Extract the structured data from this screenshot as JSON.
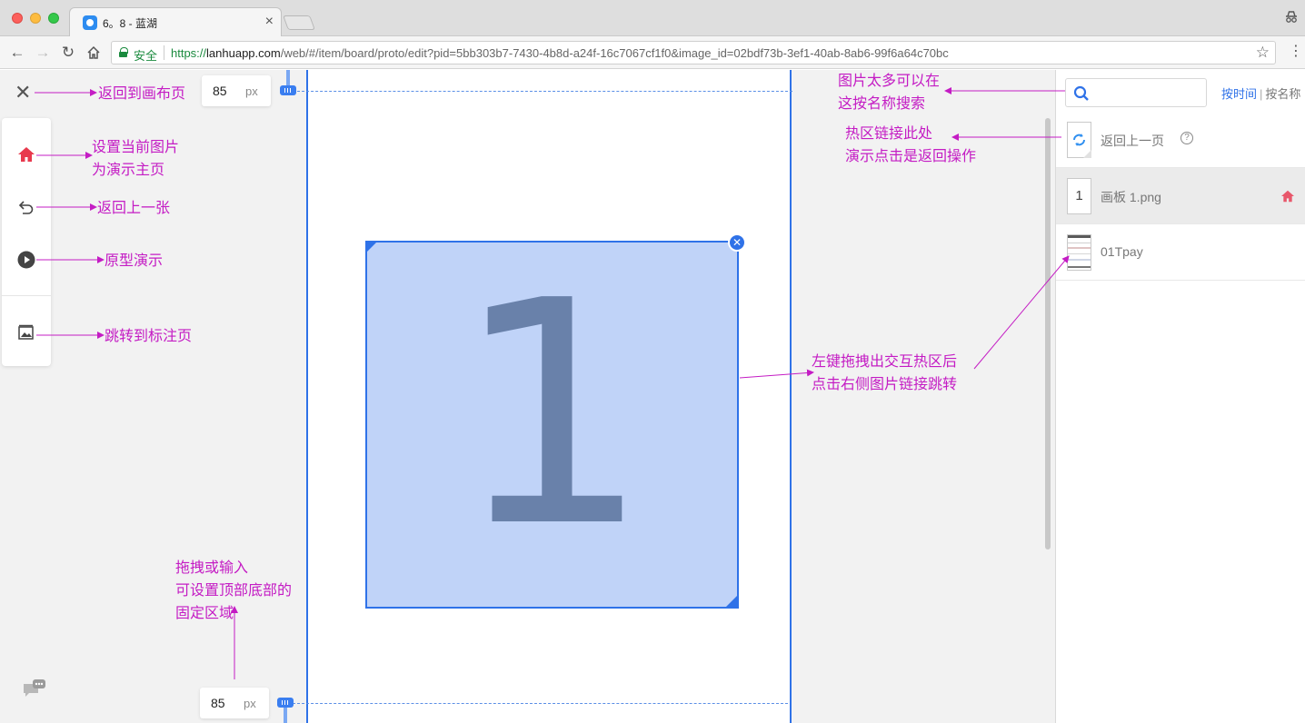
{
  "browser": {
    "tab_title": "6。8 - 蓝湖",
    "tab_close": "×",
    "secure_label": "安全",
    "url_scheme": "https://",
    "url_host": "lanhuapp.com",
    "url_rest": "/web/#/item/board/proto/edit?pid=5bb303b7-7430-4b8d-a24f-16c7067cf1f0&image_id=02bdf73b-3ef1-40ab-8ab6-99f6a64c70bc",
    "back_icon": "←",
    "forward_icon": "→",
    "reload_icon": "↻",
    "star_icon": "☆",
    "menu_icon": "⋮"
  },
  "editor": {
    "close_icon": "✕",
    "fixed_top": {
      "value": "85",
      "unit": "px"
    },
    "fixed_bottom": {
      "value": "85",
      "unit": "px"
    },
    "hotspot_label": "1",
    "hotspot_close": "✕",
    "tools": [
      "home-icon",
      "undo-icon",
      "play-icon",
      "annotation-page-icon"
    ],
    "accent_color": "#2f72e8",
    "home_color": "#e8394d"
  },
  "annotations": {
    "back_to_canvas": "返回到画布页",
    "set_home_line1": "设置当前图片",
    "set_home_line2": "为演示主页",
    "back_one": "返回上一张",
    "prototype_demo": "原型演示",
    "jump_to_annotation": "跳转到标注页",
    "drag_line1": "拖拽或输入",
    "drag_line2": "可设置顶部底部的",
    "drag_line3": "固定区域",
    "search_tip_line1": "图片太多可以在",
    "search_tip_line2": "这按名称搜索",
    "hot_link_line1": "热区链接此处",
    "hot_link_line2": "演示点击是返回操作",
    "hotspot_tip_line1": "左键拖拽出交互热区后",
    "hotspot_tip_line2": "点击右侧图片链接跳转",
    "color": "#c41cc4"
  },
  "right_panel": {
    "search_placeholder": "",
    "sort_by_time": "按时间",
    "sort_divider": "|",
    "sort_by_name": "按名称",
    "items": [
      {
        "label": "返回上一页",
        "help": "?"
      },
      {
        "thumb_number": "1",
        "label": "画板 1.png",
        "is_home": true
      },
      {
        "label": "01Tpay"
      }
    ]
  }
}
